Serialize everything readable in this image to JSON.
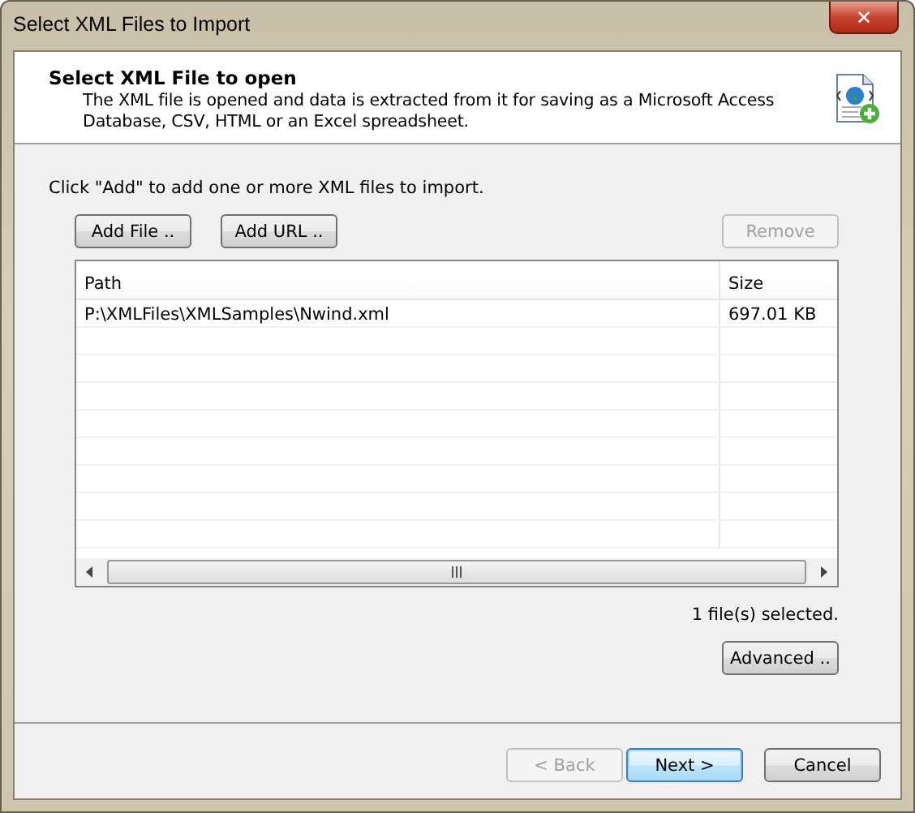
{
  "window": {
    "title": "Select XML Files to Import",
    "close": "✕"
  },
  "header": {
    "title": "Select XML File to open",
    "description": "The XML file is opened and data is extracted from it for saving as a Microsoft Access Database, CSV, HTML or an Excel spreadsheet."
  },
  "instruction": "Click \"Add\" to add one or more XML files to import.",
  "file_buttons": [
    {
      "label": "Add File ..",
      "disabled": false
    },
    {
      "label": "Add URL ..",
      "disabled": false
    },
    {
      "label": "Remove",
      "disabled": true
    }
  ],
  "table": {
    "columns": [
      "Path",
      "Size"
    ],
    "rows": [
      [
        "P:\\XMLFiles\\XMLSamples\\Nwind.xml",
        "697.01 KB"
      ]
    ]
  },
  "status": "1 file(s) selected.",
  "advanced_button": {
    "label": "Advanced ..",
    "disabled": false
  },
  "nav_buttons": [
    {
      "label": "< Back",
      "disabled": true,
      "default": false
    },
    {
      "label": "Next >",
      "disabled": false,
      "default": true
    },
    {
      "label": "Cancel",
      "disabled": false,
      "default": false
    }
  ]
}
